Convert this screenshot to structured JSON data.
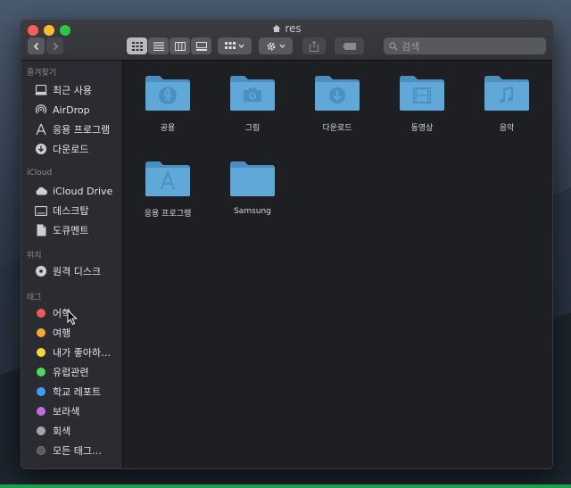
{
  "window": {
    "title": "res"
  },
  "search": {
    "placeholder": "검색"
  },
  "sidebar": {
    "favorites_header": "즐겨찾기",
    "favorites": [
      {
        "label": "최근 사용",
        "icon": "recents-icon"
      },
      {
        "label": "AirDrop",
        "icon": "airdrop-icon"
      },
      {
        "label": "응용 프로그램",
        "icon": "applications-icon"
      },
      {
        "label": "다운로드",
        "icon": "downloads-icon"
      }
    ],
    "icloud_header": "iCloud",
    "icloud": [
      {
        "label": "iCloud Drive",
        "icon": "cloud-icon"
      },
      {
        "label": "데스크탑",
        "icon": "desktop-icon"
      },
      {
        "label": "도큐멘트",
        "icon": "document-icon"
      }
    ],
    "locations_header": "위치",
    "locations": [
      {
        "label": "원격 디스크",
        "icon": "disc-icon"
      }
    ],
    "tags_header": "태그",
    "tags": [
      {
        "label": "어학",
        "color": "#f05a5a"
      },
      {
        "label": "여행",
        "color": "#f5a93b"
      },
      {
        "label": "내가 좋아하…",
        "color": "#f7d73e"
      },
      {
        "label": "유럽관련",
        "color": "#4cd964"
      },
      {
        "label": "학교 레포트",
        "color": "#3f9cf5"
      },
      {
        "label": "보라색",
        "color": "#c26be6"
      },
      {
        "label": "회색",
        "color": "#a5a5a8"
      },
      {
        "label": "모든 태그…",
        "color": "#5a5b5f"
      }
    ]
  },
  "folders": [
    {
      "label": "공용",
      "glyph": "public-icon"
    },
    {
      "label": "그림",
      "glyph": "camera-icon"
    },
    {
      "label": "다운로드",
      "glyph": "download-icon"
    },
    {
      "label": "동영상",
      "glyph": "film-icon"
    },
    {
      "label": "음악",
      "glyph": "music-icon"
    },
    {
      "label": "응용 프로그램",
      "glyph": "apps-icon"
    },
    {
      "label": "Samsung",
      "glyph": ""
    }
  ],
  "colors": {
    "folder": "#5fa8d8",
    "folder_dark": "#4a8fc0",
    "accent": "#29c940"
  }
}
